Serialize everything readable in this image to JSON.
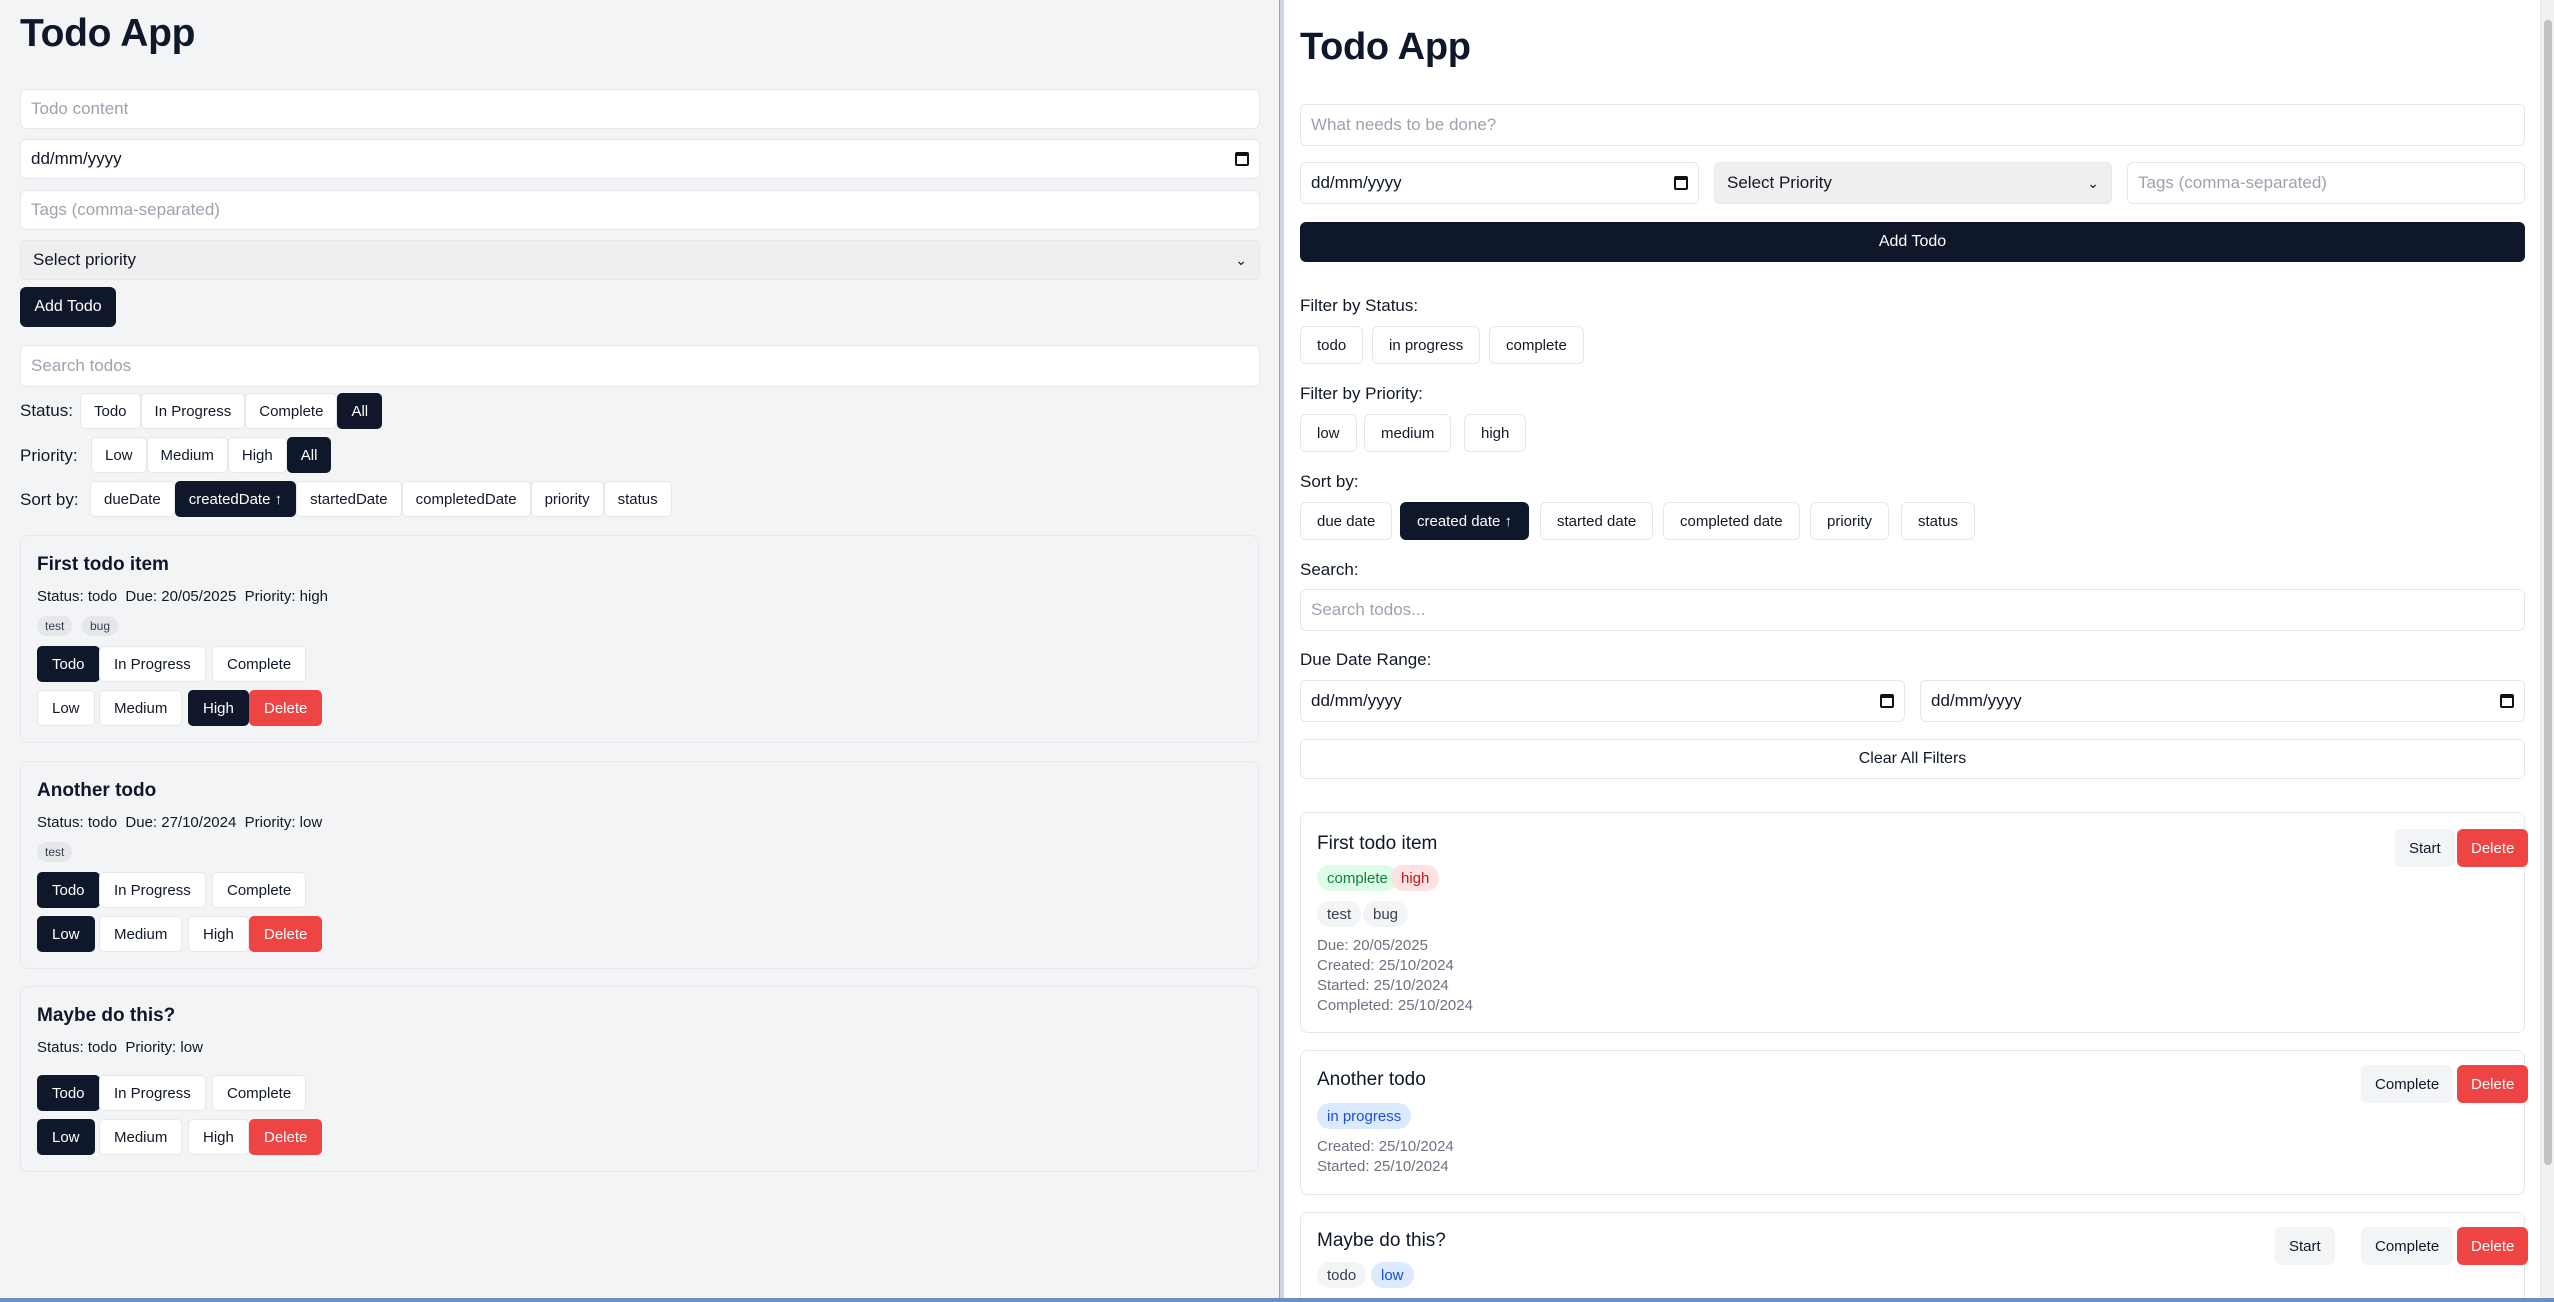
{
  "left": {
    "title": "Todo App",
    "content_placeholder": "Todo content",
    "date_value": "dd/mm/yyyy",
    "tags_placeholder": "Tags (comma-separated)",
    "priority_select": "Select priority",
    "add_button": "Add Todo",
    "search_placeholder": "Search todos",
    "status_label": "Status:",
    "status_options": [
      "Todo",
      "In Progress",
      "Complete",
      "All"
    ],
    "priority_label": "Priority:",
    "priority_options": [
      "Low",
      "Medium",
      "High",
      "All"
    ],
    "sort_label": "Sort by:",
    "sort_options": [
      "dueDate",
      "createdDate ↑",
      "startedDate",
      "completedDate",
      "priority",
      "status"
    ],
    "todos": [
      {
        "title": "First todo item",
        "meta": "Status: todo  Due: 20/05/2025  Priority: high",
        "tags": [
          "test",
          "bug"
        ]
      },
      {
        "title": "Another todo",
        "meta": "Status: todo  Due: 27/10/2024  Priority: low",
        "tags": [
          "test"
        ]
      },
      {
        "title": "Maybe do this?",
        "meta": "Status: todo  Priority: low",
        "tags": []
      }
    ],
    "status_buttons": [
      "Todo",
      "In Progress",
      "Complete"
    ],
    "priority_buttons": [
      "Low",
      "Medium",
      "High"
    ],
    "delete_label": "Delete"
  },
  "right": {
    "title": "Todo App",
    "content_placeholder": "What needs to be done?",
    "date_value": "dd/mm/yyyy",
    "priority_select": "Select Priority",
    "tags_placeholder": "Tags (comma-separated)",
    "add_button": "Add Todo",
    "filter_status_label": "Filter by Status:",
    "filter_status_options": [
      "todo",
      "in progress",
      "complete"
    ],
    "filter_priority_label": "Filter by Priority:",
    "filter_priority_options": [
      "low",
      "medium",
      "high"
    ],
    "sort_label": "Sort by:",
    "sort_options": [
      "due date",
      "created date ↑",
      "started date",
      "completed date",
      "priority",
      "status"
    ],
    "search_label": "Search:",
    "search_placeholder": "Search todos...",
    "due_range_label": "Due Date Range:",
    "range_from": "dd/mm/yyyy",
    "range_to": "dd/mm/yyyy",
    "clear_button": "Clear All Filters",
    "todos": [
      {
        "title": "First todo item",
        "status_pill": "complete",
        "priority_pill": "high",
        "tags": [
          "test",
          "bug"
        ],
        "dates": [
          "Due: 20/05/2025",
          "Created: 25/10/2024",
          "Started: 25/10/2024",
          "Completed: 25/10/2024"
        ],
        "actions": [
          "Start",
          "Delete"
        ]
      },
      {
        "title": "Another todo",
        "status_pill": "in progress",
        "dates": [
          "Created: 25/10/2024",
          "Started: 25/10/2024"
        ],
        "actions": [
          "Complete",
          "Delete"
        ]
      },
      {
        "title": "Maybe do this?",
        "status_pill": "todo",
        "priority_pill": "low",
        "actions": [
          "Start",
          "Complete",
          "Delete"
        ]
      }
    ]
  },
  "colors": {
    "primary": "#0f172a",
    "danger": "#ef4444",
    "complete_bg": "#dcfce7",
    "complete_fg": "#15803d",
    "high_bg": "#fee2e2",
    "high_fg": "#b91c1c",
    "info_bg": "#dbeafe",
    "info_fg": "#1d4ed8"
  }
}
